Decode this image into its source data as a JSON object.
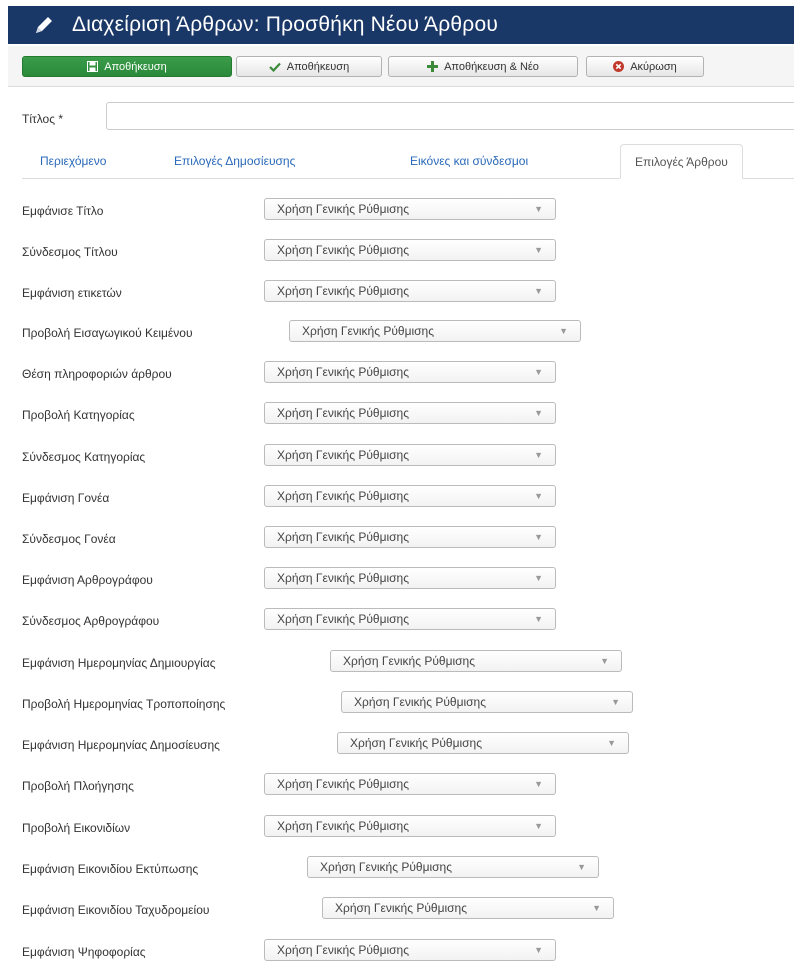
{
  "header": {
    "title": "Διαχείριση Άρθρων: Προσθήκη Νέου Άρθρου",
    "icon": "pencil-icon"
  },
  "toolbar": {
    "save_label": "Αποθήκευση",
    "save_close_label": "Αποθήκευση",
    "save_new_label": "Αποθήκευση & Νέο",
    "cancel_label": "Ακύρωση"
  },
  "form": {
    "title_label": "Τίτλος *",
    "title_value": ""
  },
  "tabs": [
    {
      "label": "Περιεχόμενο"
    },
    {
      "label": "Επιλογές Δημοσίευσης"
    },
    {
      "label": "Εικόνες και σύνδεσμοι"
    },
    {
      "label": "Επιλογές Άρθρου"
    }
  ],
  "options": [
    {
      "label": "Εμφάνισε Τίτλο",
      "value": "Χρήση Γενικής Ρύθμισης"
    },
    {
      "label": "Σύνδεσμος Τίτλου",
      "value": "Χρήση Γενικής Ρύθμισης"
    },
    {
      "label": "Εμφάνιση ετικετών",
      "value": "Χρήση Γενικής Ρύθμισης"
    },
    {
      "label": "Προβολή Εισαγωγικού Κειμένου",
      "value": "Χρήση Γενικής Ρύθμισης"
    },
    {
      "label": "Θέση πληροφοριών άρθρου",
      "value": "Χρήση Γενικής Ρύθμισης"
    },
    {
      "label": "Προβολή Κατηγορίας",
      "value": "Χρήση Γενικής Ρύθμισης"
    },
    {
      "label": "Σύνδεσμος Κατηγορίας",
      "value": "Χρήση Γενικής Ρύθμισης"
    },
    {
      "label": "Εμφάνιση Γονέα",
      "value": "Χρήση Γενικής Ρύθμισης"
    },
    {
      "label": "Σύνδεσμος Γονέα",
      "value": "Χρήση Γενικής Ρύθμισης"
    },
    {
      "label": "Εμφάνιση Αρθρογράφου",
      "value": "Χρήση Γενικής Ρύθμισης"
    },
    {
      "label": "Σύνδεσμος Αρθρογράφου",
      "value": "Χρήση Γενικής Ρύθμισης"
    },
    {
      "label": "Εμφάνιση Ημερομηνίας Δημιουργίας",
      "value": "Χρήση Γενικής Ρύθμισης"
    },
    {
      "label": "Προβολή Ημερομηνίας Τροποποίησης",
      "value": "Χρήση Γενικής Ρύθμισης"
    },
    {
      "label": "Εμφάνιση Ημερομηνίας Δημοσίευσης",
      "value": "Χρήση Γενικής Ρύθμισης"
    },
    {
      "label": "Προβολή Πλοήγησης",
      "value": "Χρήση Γενικής Ρύθμισης"
    },
    {
      "label": "Προβολή Εικονιδίων",
      "value": "Χρήση Γενικής Ρύθμισης"
    },
    {
      "label": "Εμφάνιση Εικονιδίου Εκτύπωσης",
      "value": "Χρήση Γενικής Ρύθμισης"
    },
    {
      "label": "Εμφάνιση Εικονιδίου Ταχυδρομείου",
      "value": "Χρήση Γενικής Ρύθμισης"
    },
    {
      "label": "Εμφάνιση Ψηφοφορίας",
      "value": "Χρήση Γενικής Ρύθμισης"
    }
  ],
  "colors": {
    "header_bg": "#1a3867",
    "primary_button": "#2a8a3a",
    "link": "#2a69b8",
    "cancel_icon": "#c0392b"
  }
}
